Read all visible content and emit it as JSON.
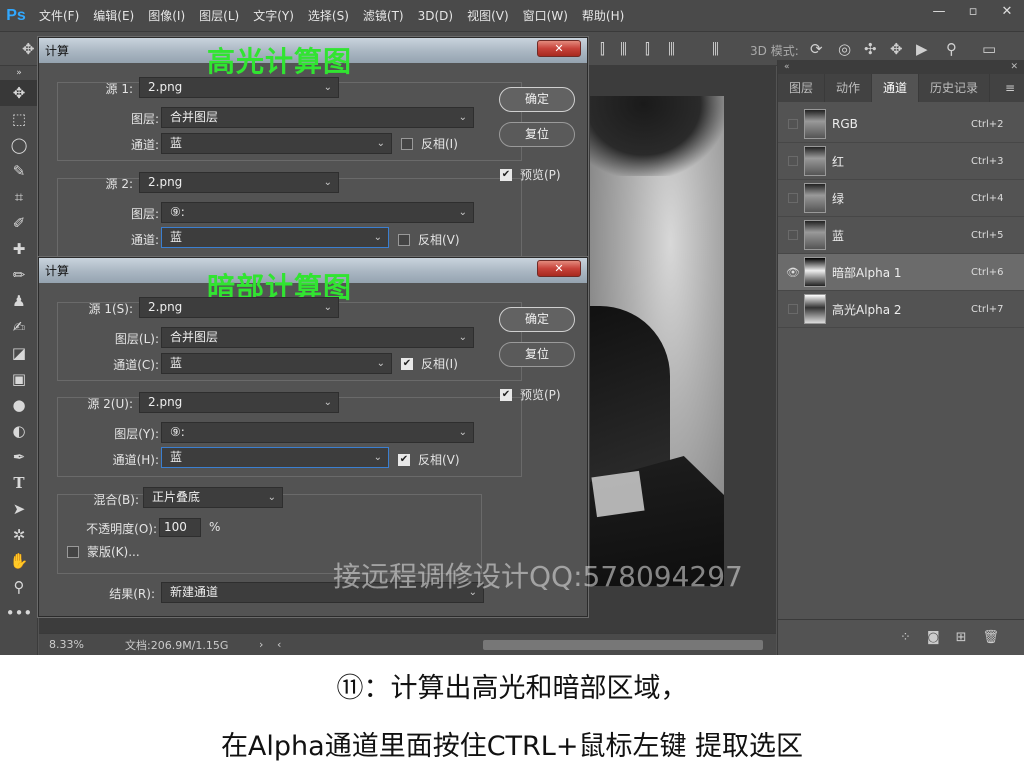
{
  "app": {
    "logo": "Ps"
  },
  "menu": [
    "文件(F)",
    "编辑(E)",
    "图像(I)",
    "图层(L)",
    "文字(Y)",
    "选择(S)",
    "滤镜(T)",
    "3D(D)",
    "视图(V)",
    "窗口(W)",
    "帮助(H)"
  ],
  "window_controls": {
    "minimize": "—",
    "maximize": "▫",
    "close": "✕"
  },
  "options_bar": {
    "mode3d_label": "3D 模式:"
  },
  "tools": [
    "move-icon",
    "marquee-icon",
    "lasso-icon",
    "quick-select-icon",
    "crop-icon",
    "eyedropper-icon",
    "healing-icon",
    "brush-icon",
    "stamp-icon",
    "history-brush-icon",
    "eraser-icon",
    "gradient-icon",
    "blur-icon",
    "dodge-icon",
    "pen-icon",
    "type-icon",
    "path-select-icon",
    "shape-icon",
    "hand-icon",
    "zoom-icon",
    "more-icon"
  ],
  "status": {
    "zoom": "8.33%",
    "doc": "文档:206.9M/1.15G",
    "arrow": "›",
    "left": "‹"
  },
  "panel": {
    "tabs": [
      "图层",
      "动作",
      "通道",
      "历史记录"
    ],
    "active_tab": "通道",
    "channels": [
      {
        "name": "RGB",
        "shortcut": "Ctrl+2",
        "visible": false
      },
      {
        "name": "红",
        "shortcut": "Ctrl+3",
        "visible": false
      },
      {
        "name": "绿",
        "shortcut": "Ctrl+4",
        "visible": false
      },
      {
        "name": "蓝",
        "shortcut": "Ctrl+5",
        "visible": false
      },
      {
        "name": "暗部Alpha 1",
        "shortcut": "Ctrl+6",
        "visible": true,
        "selected": true
      },
      {
        "name": "高光Alpha 2",
        "shortcut": "Ctrl+7",
        "visible": false
      }
    ]
  },
  "dialog1": {
    "title": "计算",
    "overlay": "高光计算图",
    "source1": {
      "label": "源 1:",
      "file": "2.png",
      "layer_label": "图层:",
      "layer": "合并图层",
      "channel_label": "通道:",
      "channel": "蓝",
      "invert": "反相(I)",
      "invert_checked": false
    },
    "source2": {
      "label": "源 2:",
      "file": "2.png",
      "layer_label": "图层:",
      "layer": "⑨:",
      "channel_label": "通道:",
      "channel": "蓝",
      "invert": "反相(V)",
      "invert_checked": false
    },
    "ok": "确定",
    "reset": "复位",
    "preview": "预览(P)",
    "preview_checked": true
  },
  "dialog2": {
    "title": "计算",
    "overlay": "暗部计算图",
    "source1": {
      "label": "源 1(S):",
      "file": "2.png",
      "layer_label": "图层(L):",
      "layer": "合并图层",
      "channel_label": "通道(C):",
      "channel": "蓝",
      "invert": "反相(I)",
      "invert_checked": true
    },
    "source2": {
      "label": "源 2(U):",
      "file": "2.png",
      "layer_label": "图层(Y):",
      "layer": "⑨:",
      "channel_label": "通道(H):",
      "channel": "蓝",
      "invert": "反相(V)",
      "invert_checked": true
    },
    "blend": {
      "label": "混合(B):",
      "value": "正片叠底",
      "opacity_label": "不透明度(O):",
      "opacity": "100",
      "percent": "%",
      "mask": "蒙版(K)..."
    },
    "result": {
      "label": "结果(R):",
      "value": "新建通道"
    },
    "ok": "确定",
    "reset": "复位",
    "preview": "预览(P)",
    "preview_checked": true
  },
  "watermark": "接远程调修设计QQ:578094297",
  "caption": {
    "line1": "⑪：计算出高光和暗部区域，",
    "line2": "在Alpha通道里面按住CTRL+鼠标左键 提取选区"
  }
}
